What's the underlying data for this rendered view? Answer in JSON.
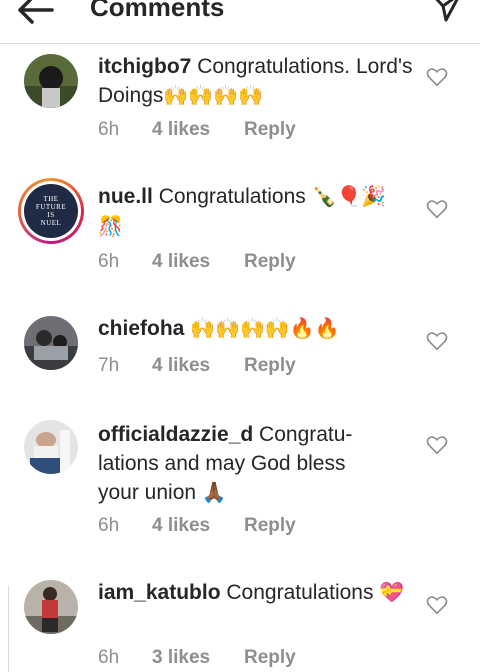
{
  "header": {
    "title": "Comments"
  },
  "comments": [
    {
      "username": "itchigbo7",
      "text": "Congratulations. Lord's Doings",
      "emoji": "🙌🙌🙌🙌",
      "time": "6h",
      "likes": "4 likes",
      "reply": "Reply",
      "avatar": "avatar-photo"
    },
    {
      "username": "nue.ll",
      "text": "Congratulations",
      "emoji": "🍾🎈🎉🎊",
      "time": "6h",
      "likes": "4 likes",
      "reply": "Reply",
      "avatar": "avatar-logo",
      "avatar_text": [
        "THE",
        "FUTURE",
        "IS",
        "NUEL"
      ]
    },
    {
      "username": "chiefoha",
      "text": "",
      "emoji": "🙌🙌🙌🙌🔥🔥",
      "time": "7h",
      "likes": "4 likes",
      "reply": "Reply",
      "avatar": "avatar-photo"
    },
    {
      "username": "officialdazzie_d",
      "text": "Congratu-lations and may God bless your union",
      "emoji": "🙏🏾",
      "time": "6h",
      "likes": "4 likes",
      "reply": "Reply",
      "avatar": "avatar-photo"
    },
    {
      "username": "iam_katublo",
      "text": "Congratulations",
      "emoji": "💝",
      "time": "6h",
      "likes": "3 likes",
      "reply": "Reply",
      "avatar": "avatar-photo"
    }
  ],
  "icons": {
    "back": "back-arrow-icon",
    "send": "send-icon",
    "like": "heart-icon"
  },
  "colors": {
    "text": "#262626",
    "muted": "#8e8e8e",
    "divider": "#dbdbdb"
  }
}
